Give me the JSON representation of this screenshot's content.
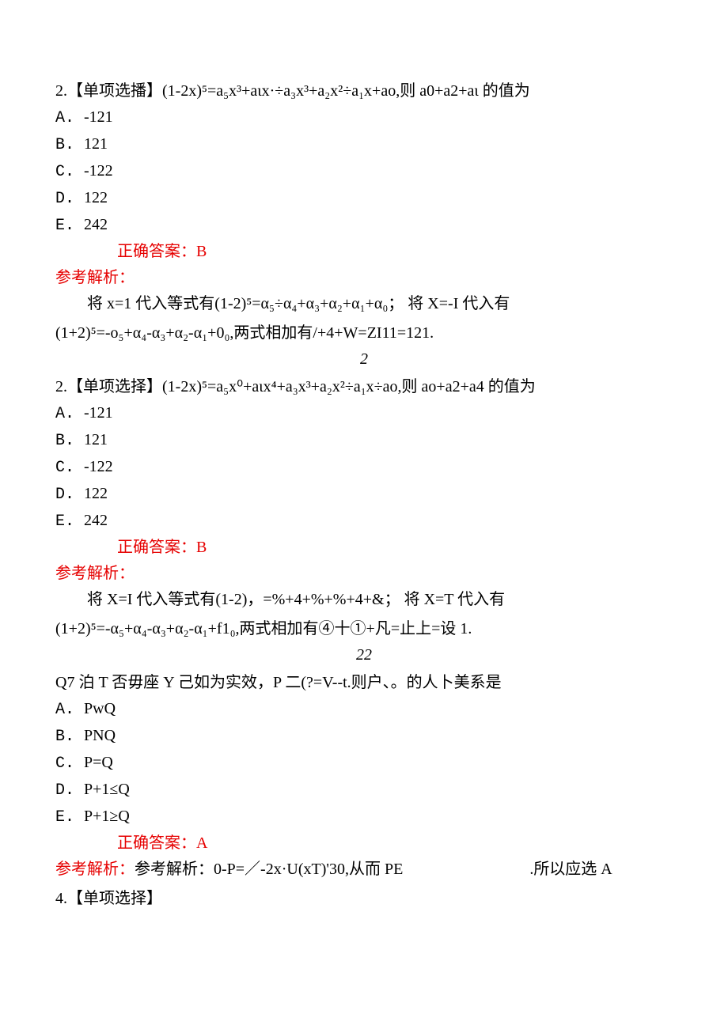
{
  "q1": {
    "stem": "2.【单项选播】(1-2x)⁵=a₅x³+aιx·÷a₃x³+a₂x²÷a₁x+ao,则 a0+a2+aι 的值为",
    "A": "-121",
    "B": "121",
    "C": "-122",
    "D": "122",
    "E": "242",
    "answer": "正确答案：B",
    "analysisHead": "参考解析：",
    "analysisBody": "将 x=1 代入等式有(1-2)⁵=α₅÷α₄+α₃+α₂+α₁+α₀；  将 X=-I 代入有",
    "formula": "(1+2)⁵=-o₅+α₄-α₃+α₂-α₁+0₀,两式相加有/+4+W=ZI11=121.",
    "frac": "2"
  },
  "q2": {
    "stem": "2.【单项选择】(1-2x)⁵=a₅x⁰+aιx⁴+a₃x³+a₂x²÷a₁x÷ao,则 ao+a2+a4 的值为",
    "A": "-121",
    "B": "121",
    "C": "-122",
    "D": "122",
    "E": "242",
    "answer": "正确答案：B",
    "analysisHead": "参考解析：",
    "analysisBody": "将 X=I 代入等式有(1-2)，=%+4+%+%+4+&；  将 X=T 代入有",
    "formula": "(1+2)⁵=-α₅+α₄-α₃+α₂-α₁+f1₀,两式相加有④十①+凡=止上=设 1.",
    "frac": "22"
  },
  "q3": {
    "stem": "Q7 泊 T 否毋座 Y 己如为实效，P 二(?=V--t.则户、。的人卜美系是",
    "A": "PwQ",
    "B": "PNQ",
    "C": "P=Q",
    "D": "P+1≤Q",
    "E": "P+1≥Q",
    "answer": "正确答案：A",
    "analysisLine": "参考解析：0-P=／-2x·U(xT)'30,从而 PE",
    "analysisTail": ".所以应选 A"
  },
  "q4": {
    "stem": "4.【单项选择】"
  },
  "labels": {
    "A": "A.",
    "B": "B.",
    "C": "C.",
    "D": "D.",
    "E": "E."
  }
}
